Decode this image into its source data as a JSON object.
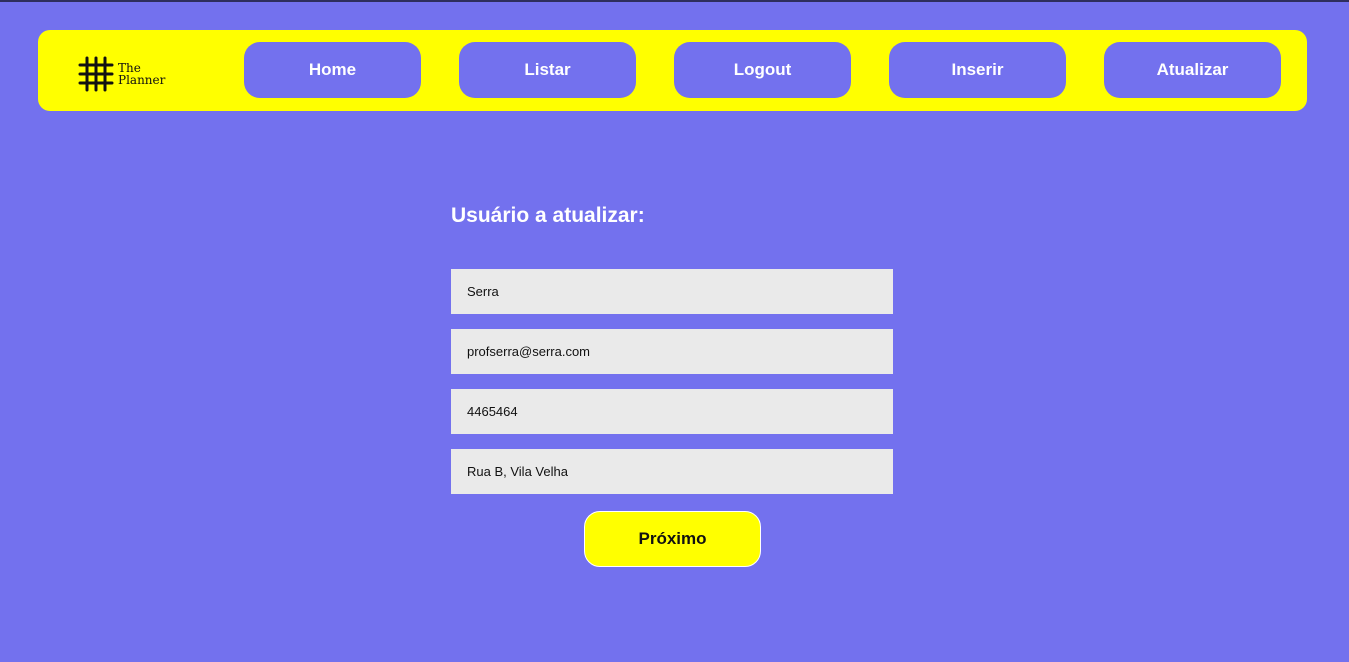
{
  "brand": {
    "logo_text_line1": "The",
    "logo_text_line2": "Planner",
    "logo_icon": "hash-grid-icon"
  },
  "nav": {
    "home": "Home",
    "listar": "Listar",
    "logout": "Logout",
    "inserir": "Inserir",
    "atualizar": "Atualizar"
  },
  "form": {
    "title": "Usuário a atualizar:",
    "name_value": "Serra",
    "email_value": "profserra@serra.com",
    "phone_value": "4465464",
    "address_value": "Rua B, Vila Velha",
    "next_label": "Próximo"
  },
  "colors": {
    "background": "#7371ee",
    "accent": "#ffff00",
    "field": "#eaeaea"
  }
}
